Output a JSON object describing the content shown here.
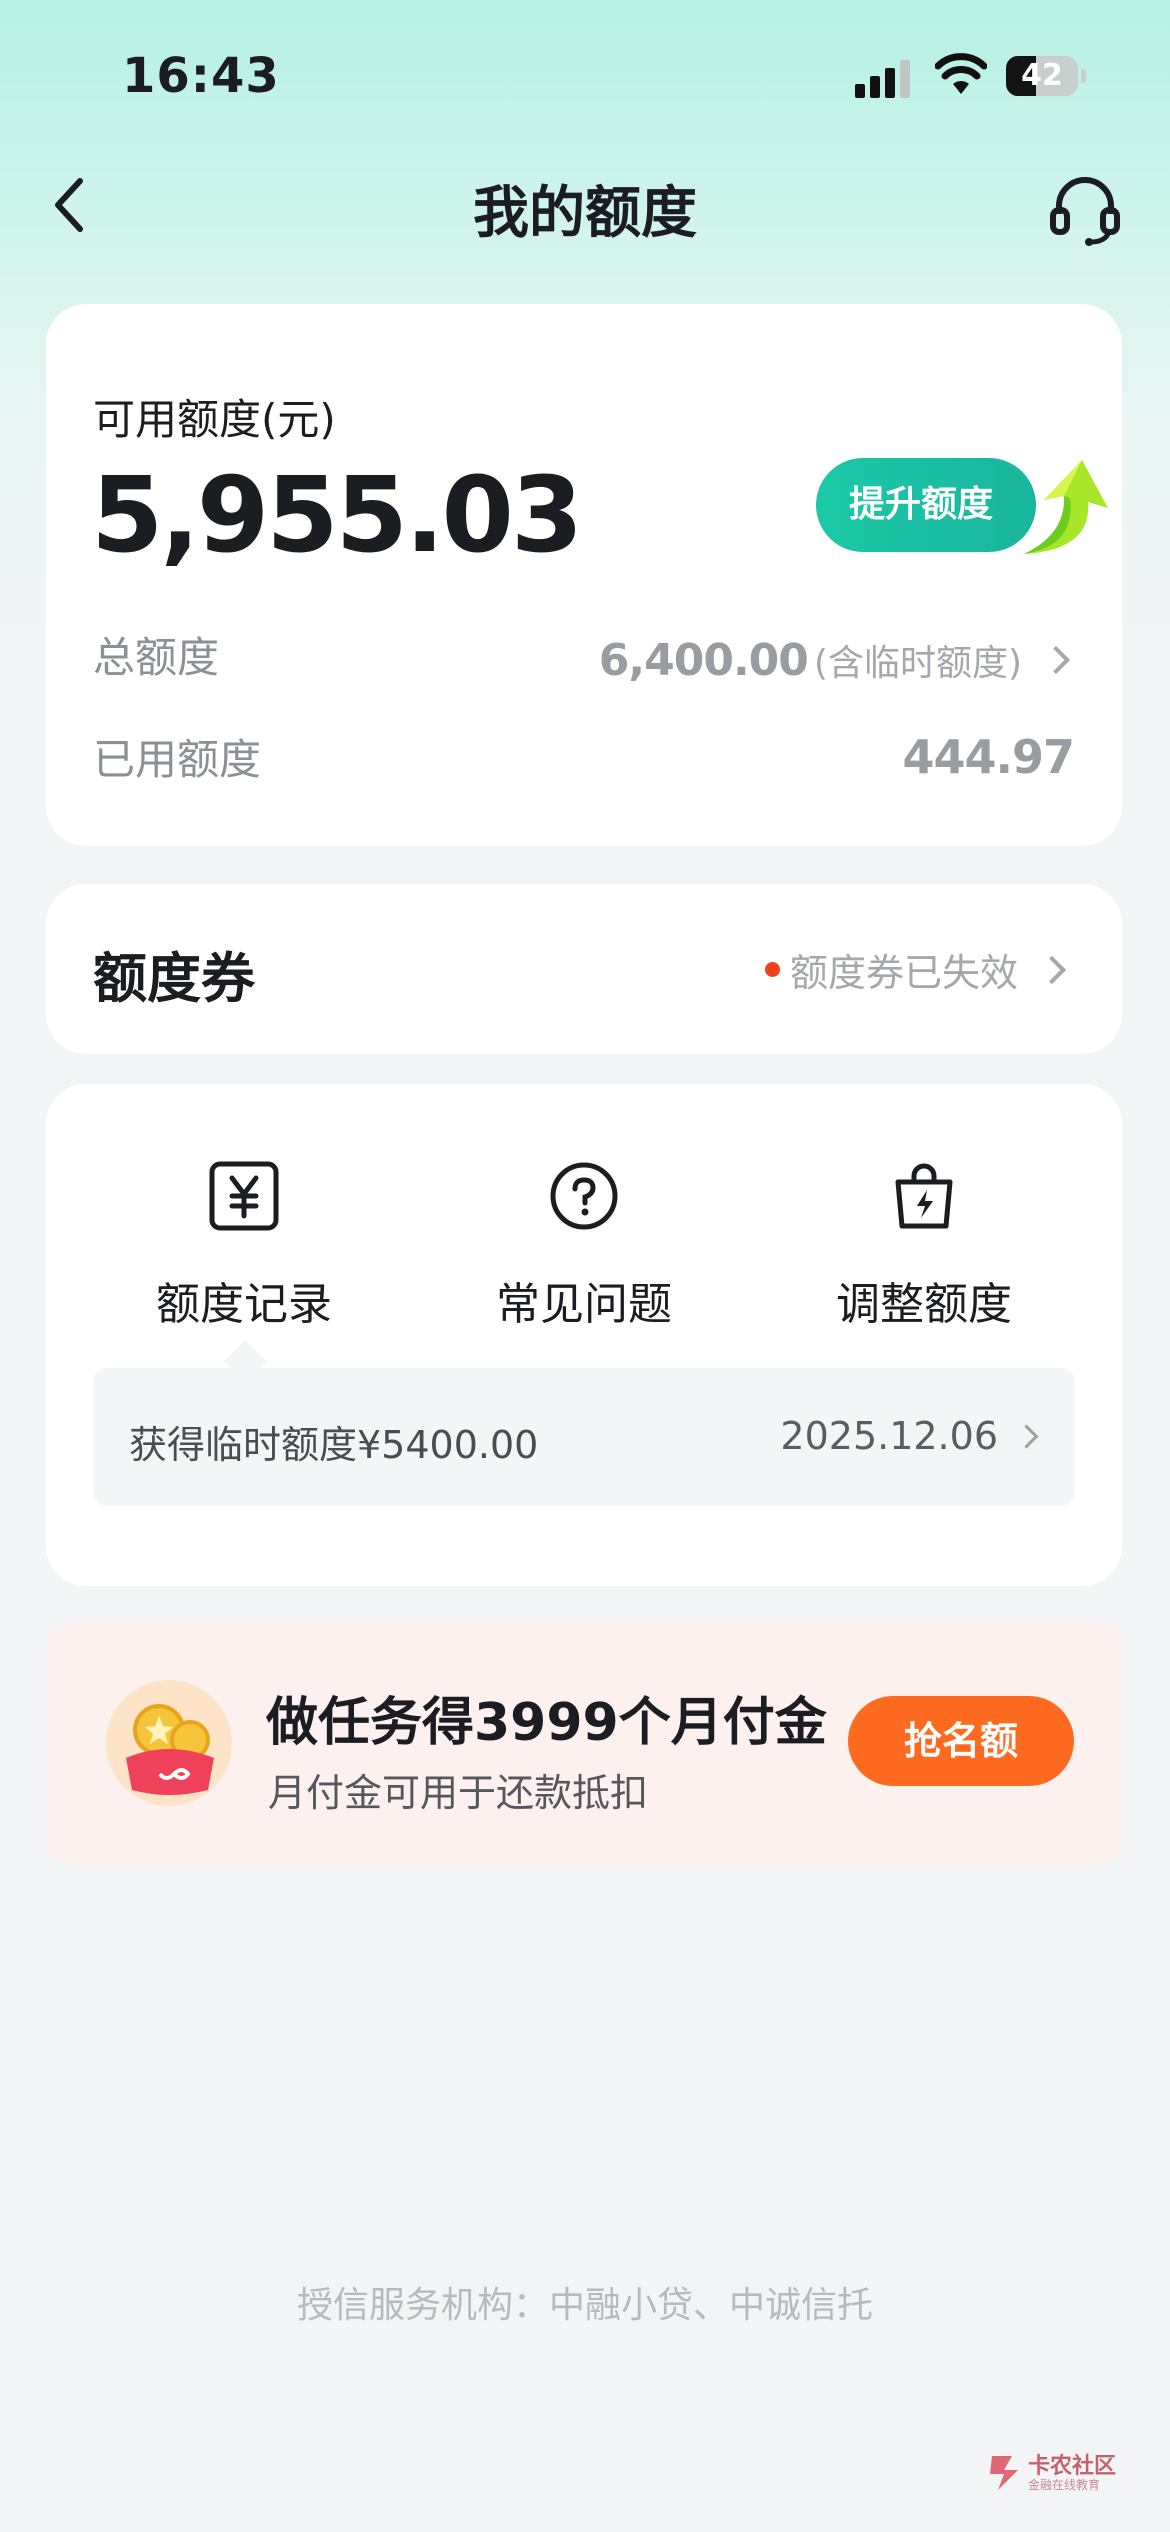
{
  "status_bar": {
    "time": "16:43",
    "battery": "42",
    "battery_level": 0.42
  },
  "nav": {
    "title": "我的额度"
  },
  "credit": {
    "available_label": "可用额度(元)",
    "available_value": "5,955.03",
    "raise_button": "提升额度",
    "total_label": "总额度",
    "total_value": "6,400.00",
    "total_note": "(含临时额度)",
    "used_label": "已用额度",
    "used_value": "444.97"
  },
  "coupon": {
    "title": "额度券",
    "status": "额度券已失效"
  },
  "shortcuts": [
    {
      "label": "额度记录",
      "icon": "yuan-icon"
    },
    {
      "label": "常见问题",
      "icon": "question-icon"
    },
    {
      "label": "调整额度",
      "icon": "lightning-bag-icon"
    }
  ],
  "record": {
    "text": "获得临时额度¥5400.00",
    "date": "2025.12.06"
  },
  "promo": {
    "title": "做任务得3999个月付金",
    "subtitle": "月付金可用于还款抵扣",
    "button": "抢名额",
    "accent": "#ff6a21"
  },
  "footer": {
    "text": "授信服务机构：中融小贷、中诚信托"
  },
  "watermark": {
    "name": "卡农社区",
    "tagline": "金融在线教育"
  },
  "colors": {
    "brand": "#1bc9a7",
    "alert_dot": "#f0401c"
  }
}
